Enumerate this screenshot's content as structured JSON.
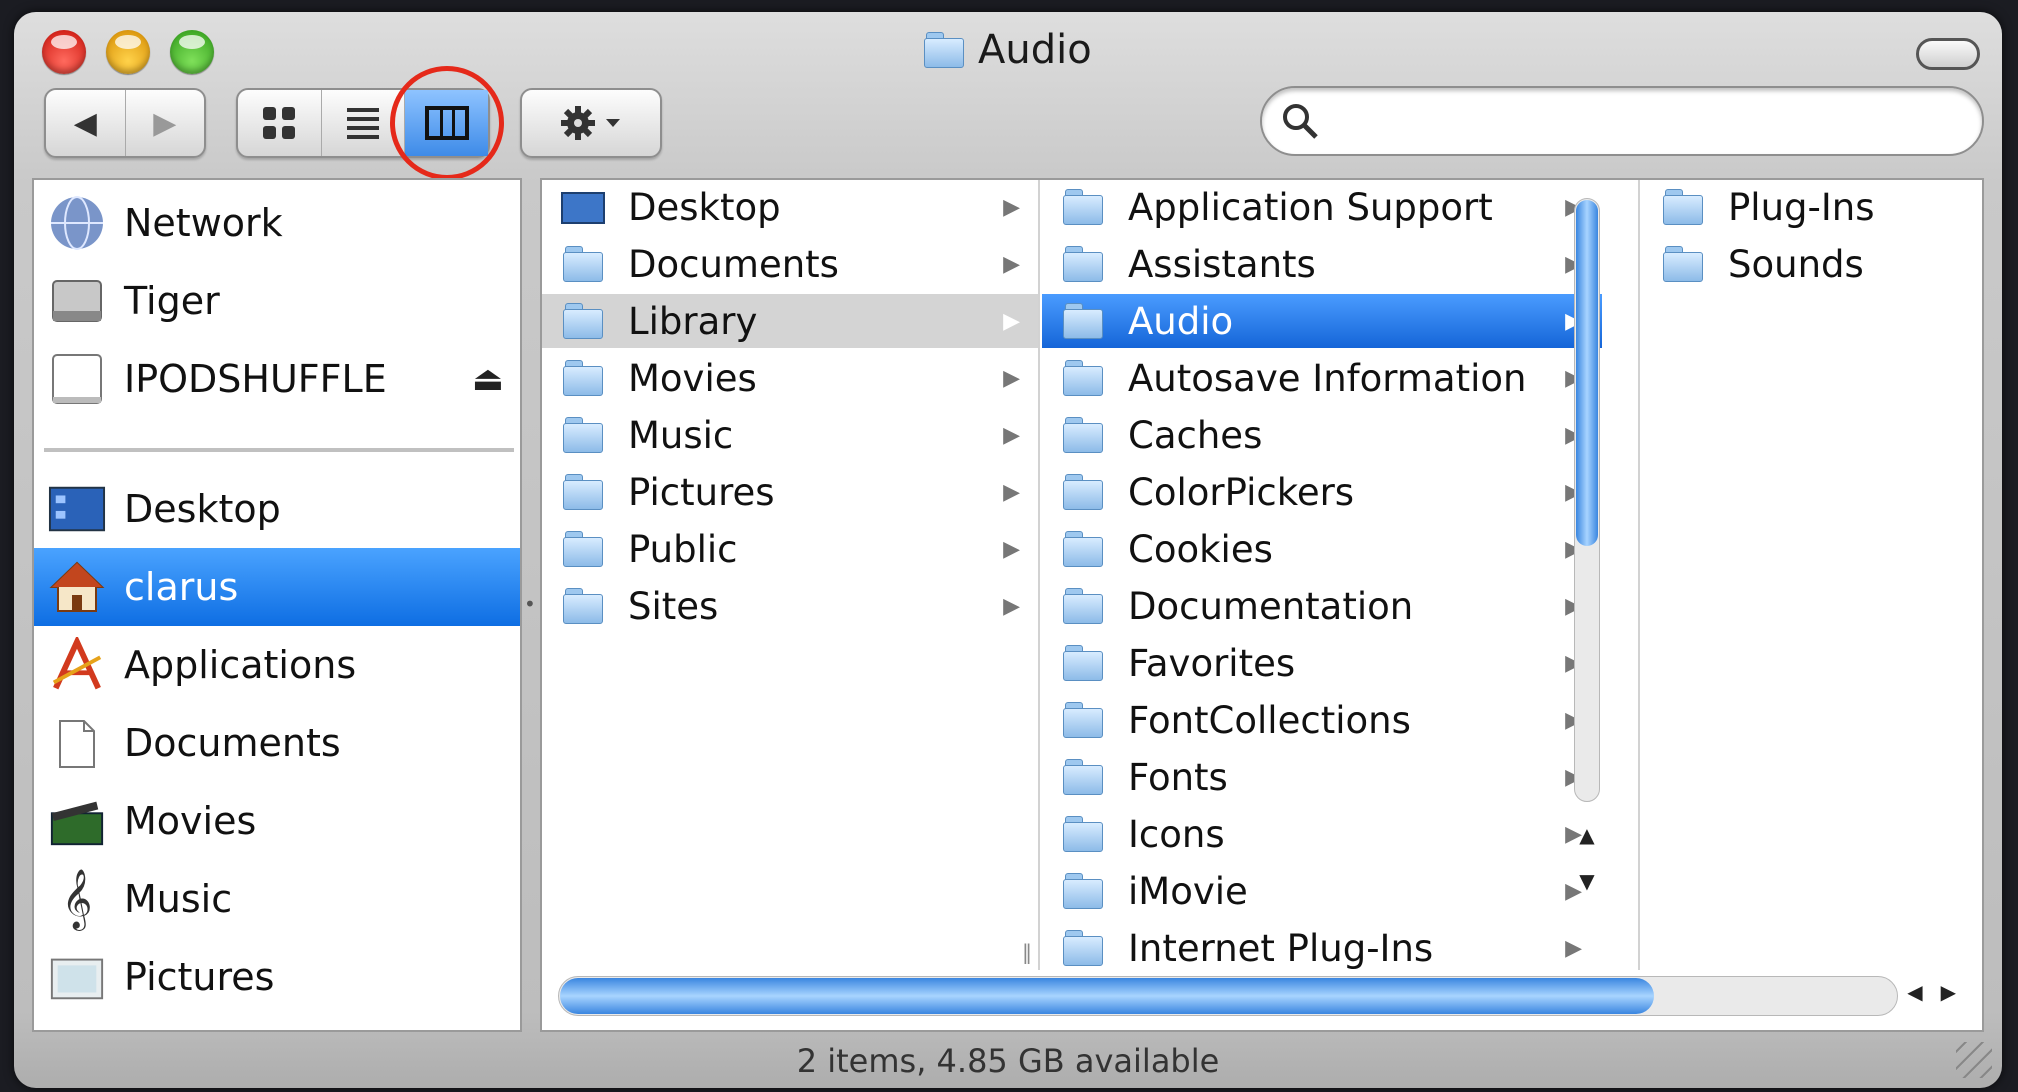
{
  "window": {
    "title": "Audio"
  },
  "toolbar": {
    "back_icon": "back-arrow-icon",
    "forward_icon": "forward-arrow-icon",
    "view_modes": [
      "icon-view",
      "list-view",
      "column-view"
    ],
    "active_view": "column-view",
    "action_icon": "gear-icon",
    "search_placeholder": ""
  },
  "sidebar": {
    "devices": [
      {
        "label": "Network",
        "icon": "network-globe-icon"
      },
      {
        "label": "Tiger",
        "icon": "hard-drive-icon"
      },
      {
        "label": "IPODSHUFFLE",
        "icon": "ipod-drive-icon",
        "eject": "⏏"
      }
    ],
    "places": [
      {
        "label": "Desktop",
        "icon": "desktop-icon"
      },
      {
        "label": "clarus",
        "icon": "home-icon",
        "selected": true
      },
      {
        "label": "Applications",
        "icon": "applications-icon"
      },
      {
        "label": "Documents",
        "icon": "documents-icon"
      },
      {
        "label": "Movies",
        "icon": "movies-icon"
      },
      {
        "label": "Music",
        "icon": "music-icon"
      },
      {
        "label": "Pictures",
        "icon": "pictures-icon"
      }
    ]
  },
  "columns": {
    "home": [
      "Desktop",
      "Documents",
      "Library",
      "Movies",
      "Music",
      "Pictures",
      "Public",
      "Sites"
    ],
    "library": [
      "Application Support",
      "Assistants",
      "Audio",
      "Autosave Information",
      "Caches",
      "ColorPickers",
      "Cookies",
      "Documentation",
      "Favorites",
      "FontCollections",
      "Fonts",
      "Icons",
      "iMovie",
      "Internet Plug-Ins"
    ],
    "audio": [
      "Plug-Ins",
      "Sounds"
    ]
  },
  "arrow_glyph": "▶",
  "status_bar": {
    "text": "2 items, 4.85 GB available"
  },
  "colors": {
    "selection": "#1565d8",
    "highlight_circle": "#e5291a"
  }
}
